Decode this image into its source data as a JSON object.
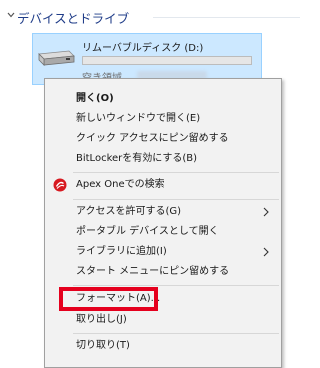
{
  "section": {
    "title": "デバイスとドライブ"
  },
  "drive": {
    "name": "リムーバブルディスク (D:)",
    "free_label": "空き領域",
    "used_fraction": 0,
    "bar_color": "#26a0da"
  },
  "menu": {
    "items": [
      {
        "label": "開く(O)"
      },
      {
        "label": "新しいウィンドウで開く(E)"
      },
      {
        "label": "クイック アクセスにピン留めする"
      },
      {
        "label": "BitLockerを有効にする(B)"
      },
      {
        "label": "Apex Oneでの検索",
        "icon": "apex-one-icon"
      },
      {
        "label": "アクセスを許可する(G)",
        "submenu": true
      },
      {
        "label": "ポータブル デバイスとして開く"
      },
      {
        "label": "ライブラリに追加(I)",
        "submenu": true
      },
      {
        "label": "スタート メニューにピン留めする"
      },
      {
        "label": "フォーマット(A)..."
      },
      {
        "label": "取り出し(J)"
      },
      {
        "label": "切り取り(T)"
      }
    ]
  },
  "annotation": {
    "color": "#e5001e",
    "target": "フォーマット(A)..."
  }
}
